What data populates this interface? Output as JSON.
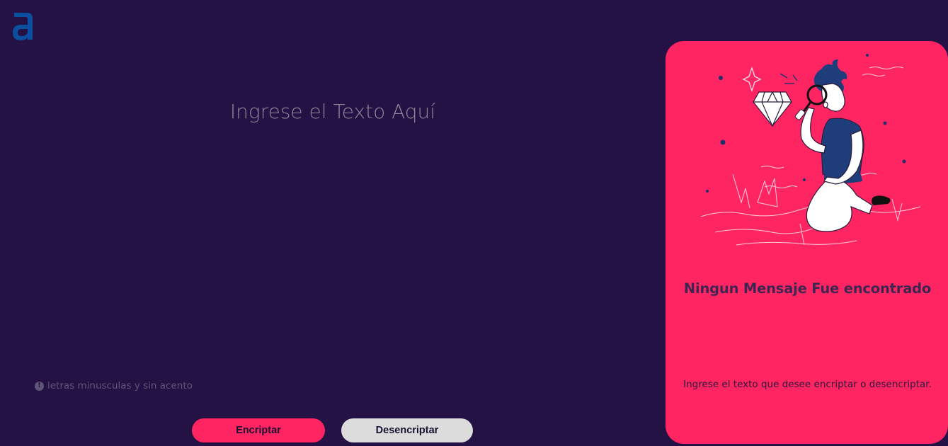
{
  "brand": {
    "logo_icon": "letter-a-logo-icon",
    "color": "#0b4fa0"
  },
  "input": {
    "placeholder": "Ingrese el Texto Aquí",
    "value": ""
  },
  "hint": {
    "icon": "exclamation-circle-icon",
    "text": "letras minusculas y sin acento"
  },
  "buttons": {
    "encrypt_label": "Encriptar",
    "decrypt_label": "Desencriptar"
  },
  "output_panel": {
    "illustration": "person-with-magnifier-examining-diamond-illustration",
    "title": "Ningun Mensaje Fue encontrado",
    "subtitle": "Ingrese el texto que desee encriptar o desencriptar."
  },
  "colors": {
    "background": "#251245",
    "accent": "#ff2563",
    "secondary_button": "#dcdcdc"
  }
}
